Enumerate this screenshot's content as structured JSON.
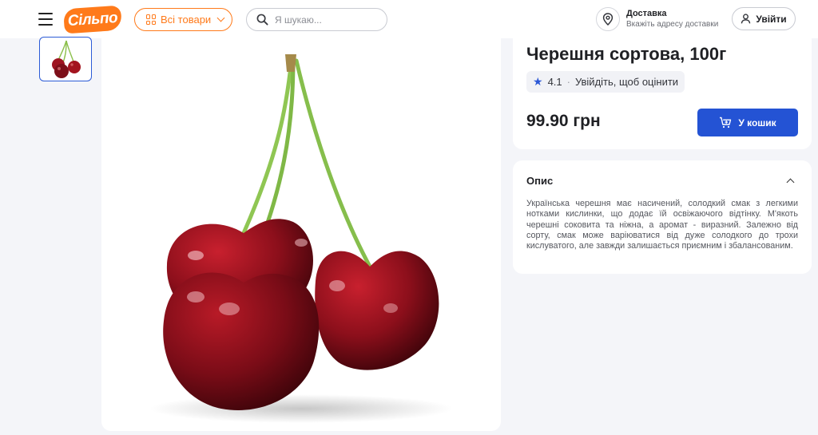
{
  "header": {
    "logo_text": "Сільпо",
    "catalog_label": "Всі товари",
    "search_placeholder": "Я шукаю...",
    "delivery_title": "Доставка",
    "delivery_subtitle": "Вкажіть адресу доставки",
    "login_label": "Увійти"
  },
  "product": {
    "title": "Черешня сортова, 100г",
    "rating": "4.1",
    "rating_separator": "·",
    "rating_cta": "Увійдіть, щоб оцінити",
    "price": "99.90 грн",
    "cart_label": "У кошик"
  },
  "description": {
    "title": "Опис",
    "text": "Українська черешня має насичений, солодкий смак з легкими нотками кислинки, що додає їй освіжаючого відтінку. М'якоть черешні соковита та ніжна, а аромат - виразний. Залежно від сорту, смак може варіюватися від дуже солодкого до трохи кислуватого, але завжди залишається приємним і збалансованим."
  },
  "colors": {
    "brand_orange": "#ff7a1a",
    "primary_blue": "#2453d4",
    "background": "#f4f5f9"
  },
  "icons": {
    "menu": "burger-icon",
    "catalog": "grid-icon",
    "search": "search-icon",
    "location": "location-pin-icon",
    "user": "user-icon",
    "star": "star-icon",
    "cart": "cart-add-icon",
    "collapse": "chevron-up-icon"
  }
}
